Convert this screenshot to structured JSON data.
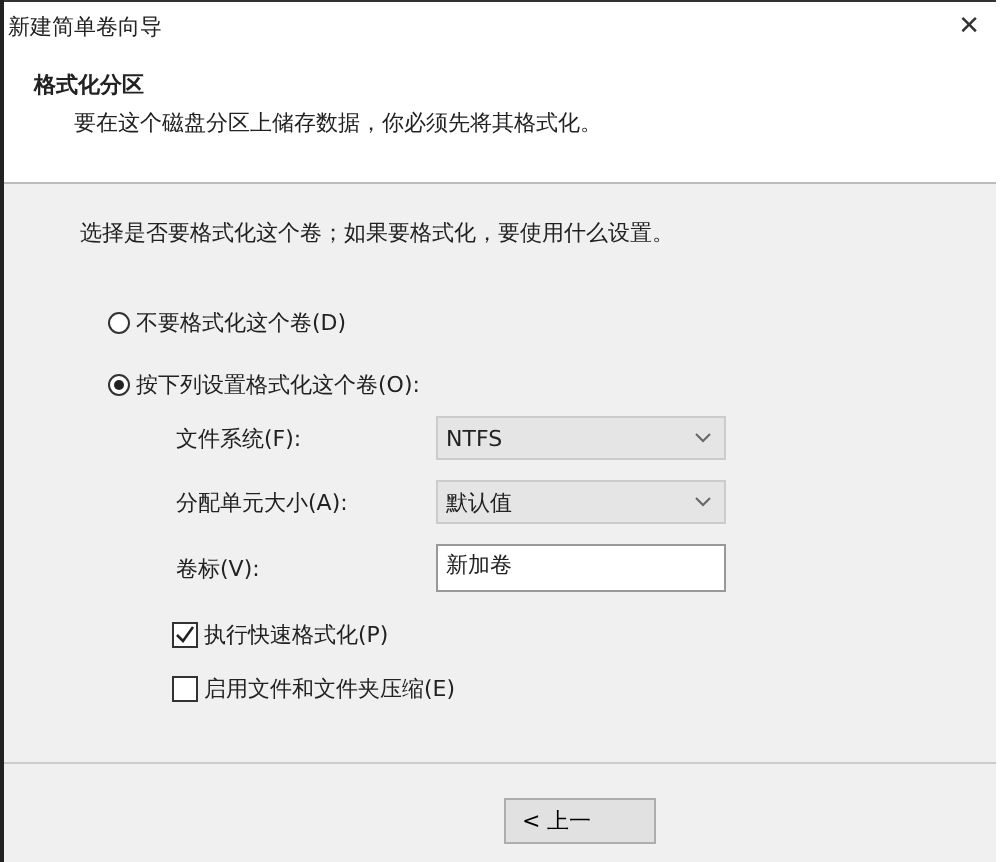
{
  "window": {
    "title": "新建简单卷向导",
    "close": "✕"
  },
  "header": {
    "title": "格式化分区",
    "subtitle": "要在这个磁盘分区上储存数据，你必须先将其格式化。"
  },
  "prompt": "选择是否要格式化这个卷；如果要格式化，要使用什么设置。",
  "options": [
    {
      "label": "不要格式化这个卷(D)",
      "selected": false
    },
    {
      "label": "按下列设置格式化这个卷(O):",
      "selected": true
    }
  ],
  "settings": [
    {
      "kind": "dropdown",
      "label": "文件系统(F):",
      "value": "NTFS"
    },
    {
      "kind": "dropdown",
      "label": "分配单元大小(A):",
      "value": "默认值"
    },
    {
      "kind": "text",
      "label": "卷标(V):",
      "value": "新加卷"
    }
  ],
  "checkboxes": [
    {
      "label": "执行快速格式化(P)",
      "checked": true
    },
    {
      "label": "启用文件和文件夹压缩(E)",
      "checked": false
    }
  ],
  "buttons": [
    "< 上一"
  ]
}
